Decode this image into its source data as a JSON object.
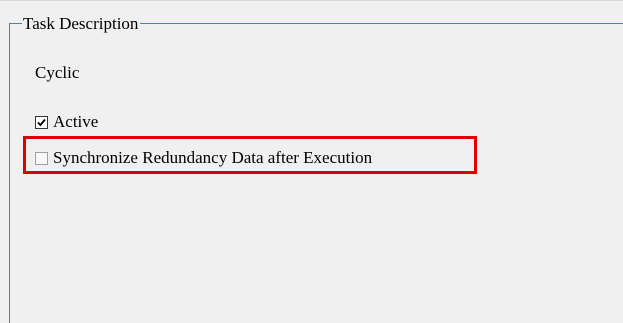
{
  "group": {
    "title": "Task Description",
    "mode_label": "Cyclic"
  },
  "options": {
    "active": {
      "label": "Active",
      "checked": true
    },
    "sync_redundancy": {
      "label": "Synchronize Redundancy Data after Execution",
      "checked": false
    }
  },
  "highlight": {
    "color": "#e00000"
  },
  "colors": {
    "background": "#f0f0f0",
    "group_border": "#4a7fc1"
  }
}
